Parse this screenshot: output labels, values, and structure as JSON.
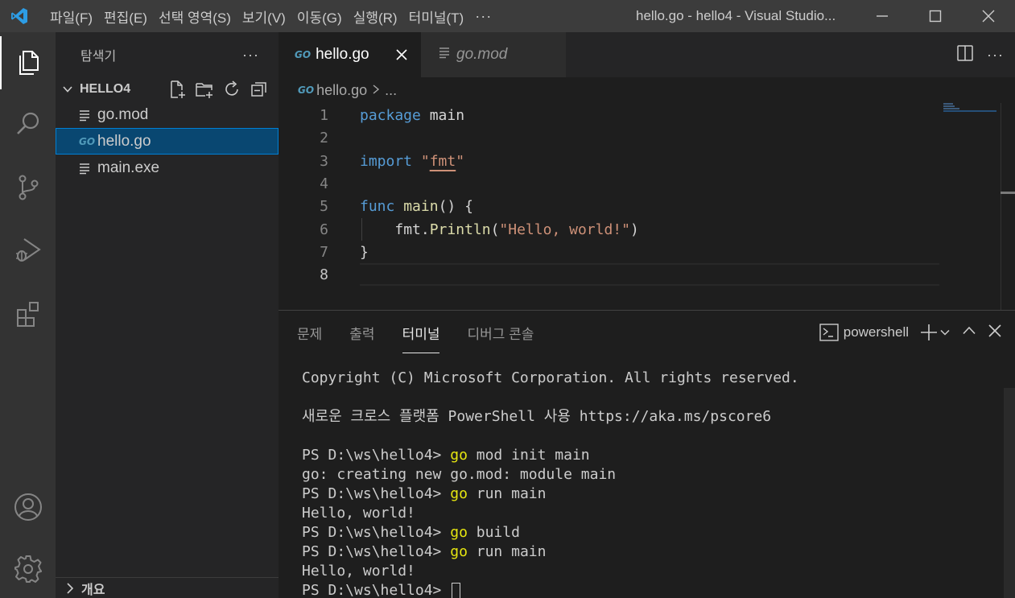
{
  "titlebar": {
    "menu": [
      "파일(F)",
      "편집(E)",
      "선택 영역(S)",
      "보기(V)",
      "이동(G)",
      "실행(R)",
      "터미널(T)"
    ],
    "more": "···",
    "window_title": "hello.go - hello4 - Visual Studio...",
    "accent": "#3c3c3c"
  },
  "activitybar": {
    "items": [
      "explorer-icon",
      "search-icon",
      "source-control-icon",
      "run-debug-icon",
      "extensions-icon"
    ],
    "bottom": [
      "account-icon",
      "settings-gear-icon"
    ]
  },
  "sidebar": {
    "title": "탐색기",
    "more": "···",
    "folder": "HELLO4",
    "files": [
      {
        "name": "go.mod",
        "icon": "lines-icon"
      },
      {
        "name": "hello.go",
        "icon": "go-file-icon",
        "selected": true
      },
      {
        "name": "main.exe",
        "icon": "lines-icon"
      }
    ],
    "outline_label": "개요"
  },
  "tabs": [
    {
      "label": "hello.go",
      "active": true
    },
    {
      "label": "go.mod",
      "active": false
    }
  ],
  "tab_more": "···",
  "breadcrumb": {
    "file": "hello.go",
    "rest": "..."
  },
  "editor": {
    "line_numbers": [
      "1",
      "2",
      "3",
      "4",
      "5",
      "6",
      "7",
      "8"
    ],
    "go_badge": "GO"
  },
  "panel": {
    "tabs": [
      "문제",
      "출력",
      "터미널",
      "디버그 콘솔"
    ],
    "active_tab": "터미널",
    "shell": "powershell",
    "terminal_lines": [
      "Copyright (C) Microsoft Corporation. All rights reserved.",
      "",
      "새로운 크로스 플랫폼 PowerShell 사용 https://aka.ms/pscore6",
      "",
      "PS D:\\ws\\hello4> |go| mod init main",
      "go: creating new go.mod: module main",
      "PS D:\\ws\\hello4> |go| run main",
      "Hello, world!",
      "PS D:\\ws\\hello4> |go| build",
      "PS D:\\ws\\hello4> |go| run main",
      "Hello, world!",
      "PS D:\\ws\\hello4> "
    ]
  }
}
